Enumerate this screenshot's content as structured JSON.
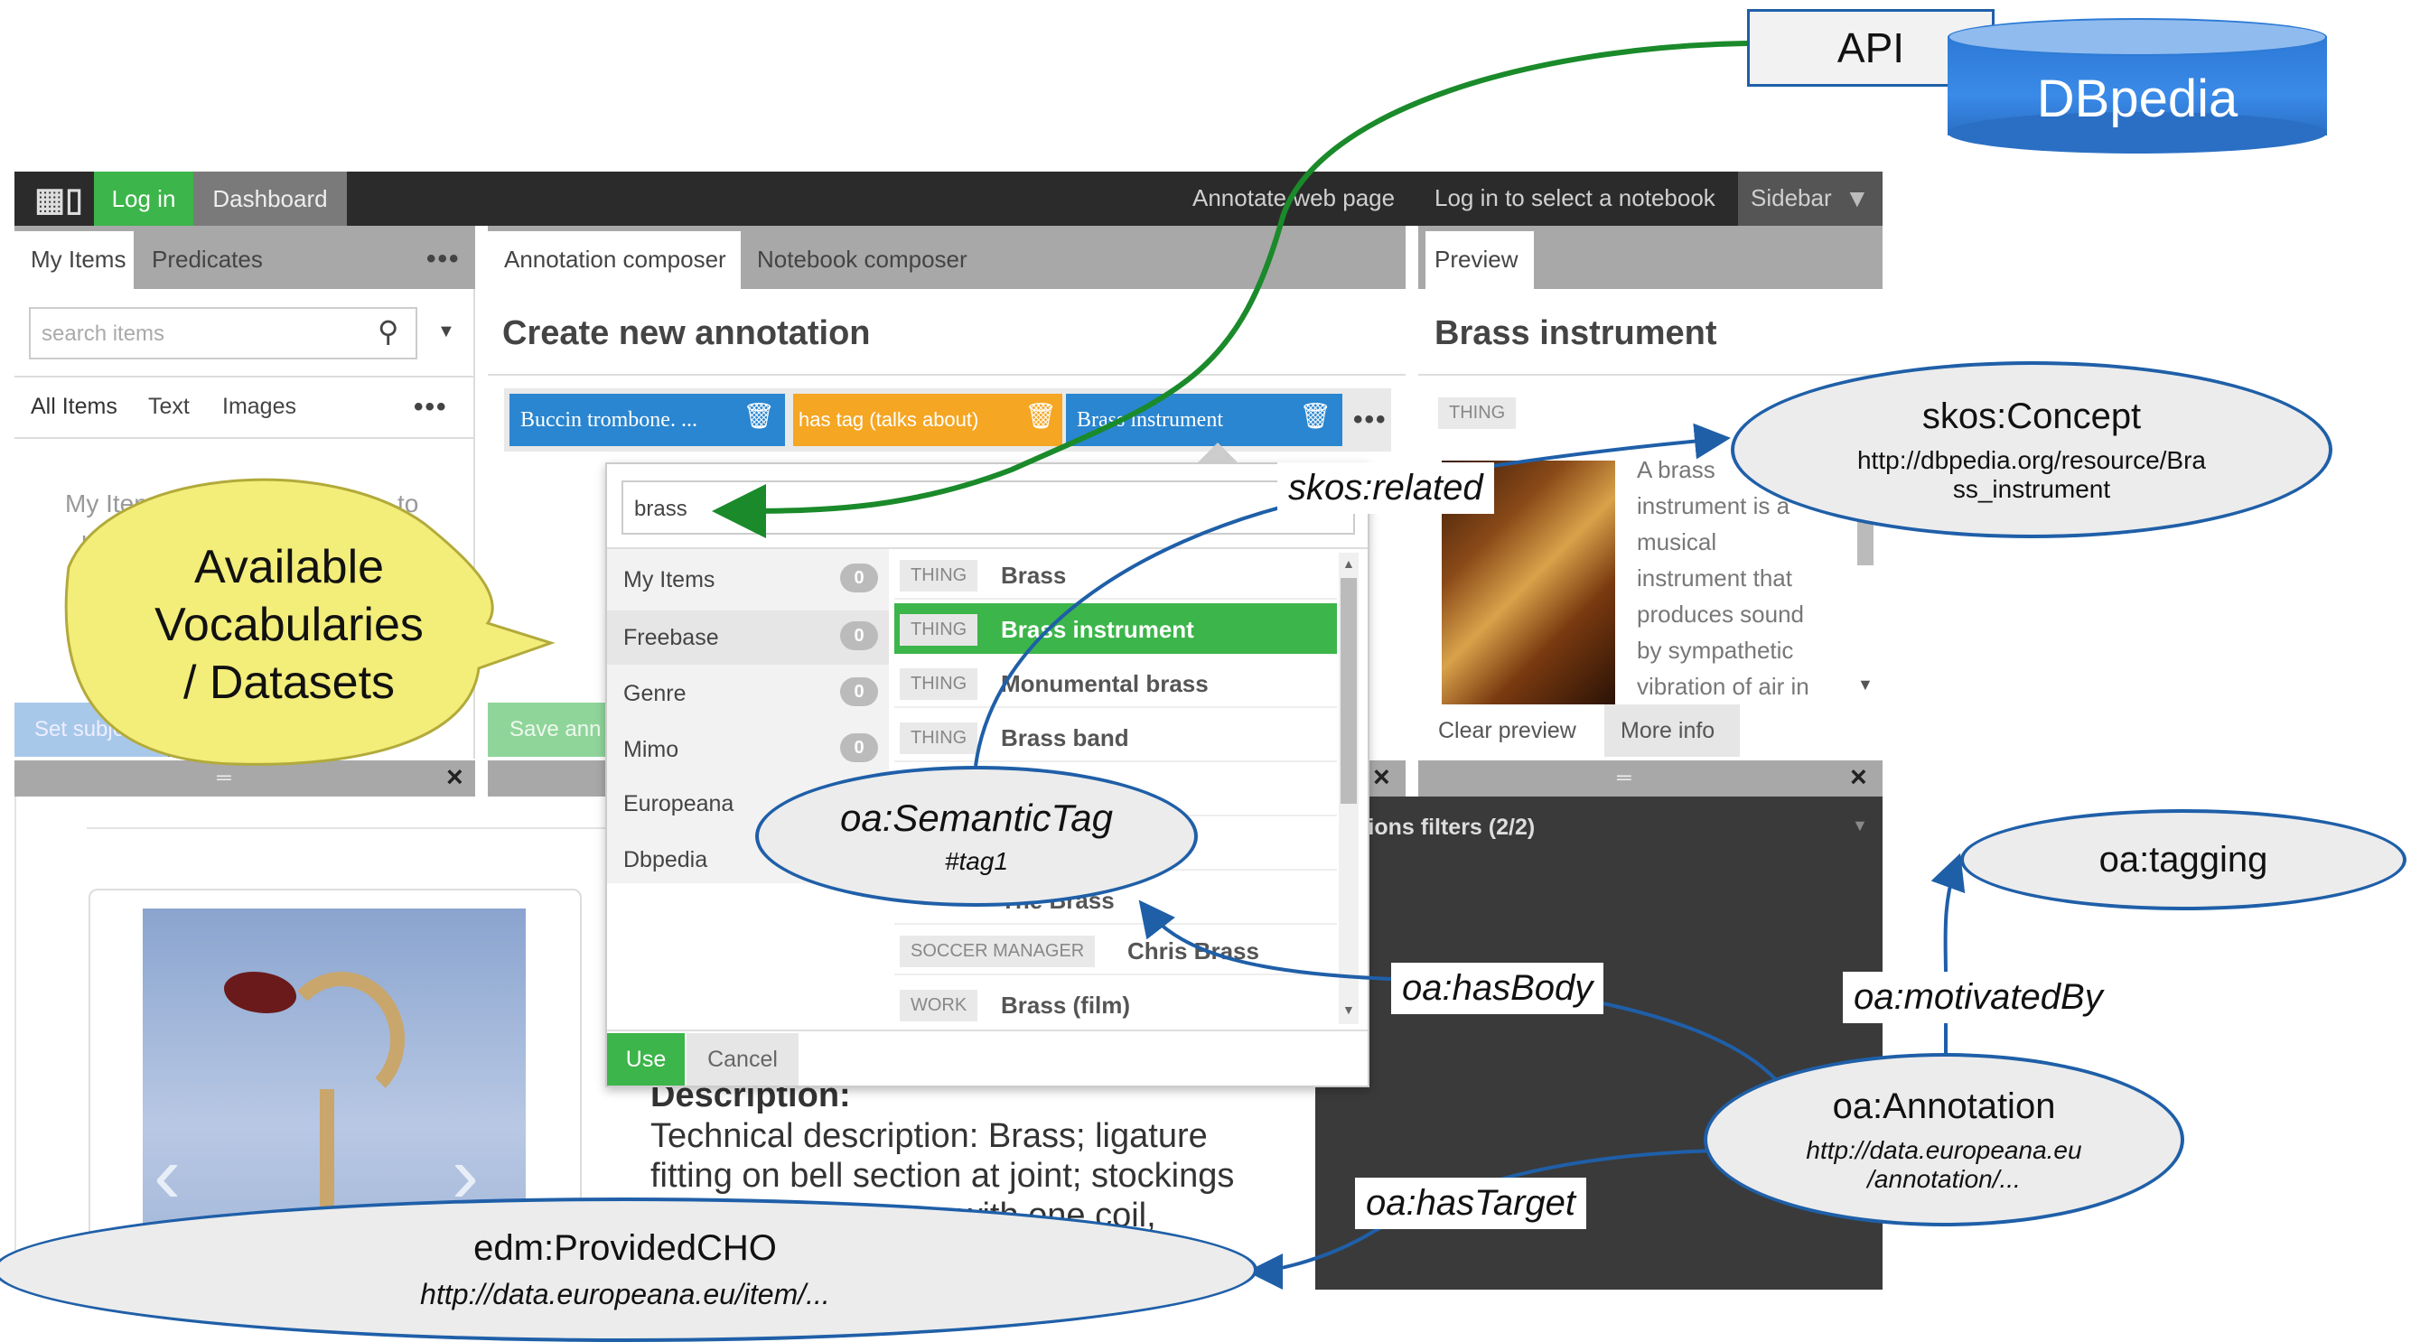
{
  "api": {
    "label": "API"
  },
  "dbpedia": {
    "label": "DBpedia"
  },
  "topbar": {
    "login": "Log in",
    "dashboard": "Dashboard",
    "annotate": "Annotate web page",
    "notebook": "Log in to select a notebook",
    "sidebar": "Sidebar"
  },
  "left": {
    "tabs": [
      "My Items",
      "Predicates"
    ],
    "search_placeholder": "search items",
    "subtabs": [
      "All Items",
      "Text",
      "Images"
    ],
    "empty": [
      "My Items",
      "to",
      "lo"
    ],
    "set_subject": "Set subje"
  },
  "composer": {
    "tabs": [
      "Annotation composer",
      "Notebook composer"
    ],
    "title": "Create new annotation",
    "subject": "Buccin trombone. ...",
    "predicate": "has tag (talks about)",
    "object": "Brass instrument",
    "save": "Save ann"
  },
  "dropdown": {
    "query": "brass",
    "sources": [
      {
        "name": "My Items",
        "count": "0"
      },
      {
        "name": "Freebase",
        "count": "0"
      },
      {
        "name": "Genre",
        "count": "0"
      },
      {
        "name": "Mimo",
        "count": "0"
      },
      {
        "name": "Europeana",
        "count": ""
      },
      {
        "name": "Dbpedia",
        "count": ""
      }
    ],
    "results": [
      {
        "type": "THING",
        "name": "Brass"
      },
      {
        "type": "THING",
        "name": "Brass instrument"
      },
      {
        "type": "THING",
        "name": "Monumental brass"
      },
      {
        "type": "THING",
        "name": "Brass band"
      },
      {
        "type": "",
        "name": ""
      },
      {
        "type": "",
        "name": ""
      },
      {
        "type": "",
        "name": "The Brass"
      },
      {
        "type": "SOCCER MANAGER",
        "name": "Chris Brass"
      },
      {
        "type": "WORK",
        "name": "Brass (film)"
      }
    ],
    "use": "Use",
    "cancel": "Cancel"
  },
  "preview": {
    "tab": "Preview",
    "title": "Brass instrument",
    "tag": "THING",
    "description": [
      "A brass",
      "instrument is a",
      "musical",
      "instrument that",
      "produces sound",
      "by sympathetic",
      "vibration of air in"
    ],
    "clear": "Clear preview",
    "more": "More info"
  },
  "filters": {
    "label": "Annotations filters (2/2)"
  },
  "item": {
    "description_heading": "Description:",
    "description_lines": [
      "Technical description: Brass; ligature",
      "fitting on bell section at joint; stockings",
      "with one coil,"
    ]
  },
  "callout": {
    "lines": [
      "Available",
      "Vocabularies",
      "/ Datasets"
    ]
  },
  "diagram": {
    "skos_concept": {
      "title": "skos:Concept",
      "uri_lines": [
        "http://dbpedia.org/resource/Bra",
        "ss_instrument"
      ]
    },
    "skos_related": "skos:related",
    "semantic_tag": {
      "title": "oa:SemanticTag",
      "sub": "#tag1"
    },
    "tagging": "oa:tagging",
    "has_body": "oa:hasBody",
    "motivated_by": "oa:motivatedBy",
    "annotation": {
      "title": "oa:Annotation",
      "uri_lines": [
        "http://data.europeana.eu",
        "/annotation/..."
      ]
    },
    "has_target": "oa:hasTarget",
    "provided_cho": {
      "title": "edm:ProvidedCHO",
      "uri": "http://data.europeana.eu/item/..."
    }
  },
  "colors": {
    "green_arrow": "#1a8a2a",
    "blue_arrow": "#1f5fa8",
    "accent_green": "#3cb54a",
    "topbar": "#2b2b2b",
    "tab_gray": "#a8a8a8"
  }
}
